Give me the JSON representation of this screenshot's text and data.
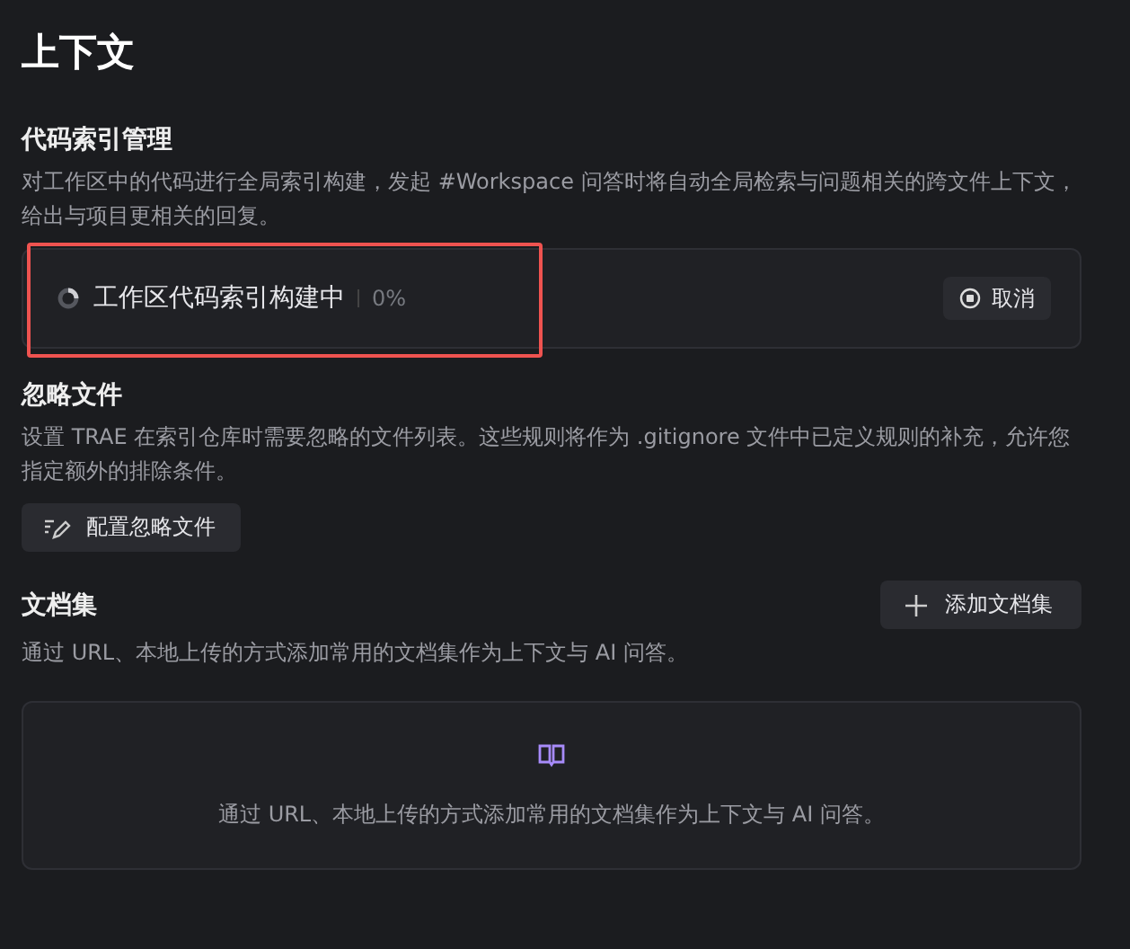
{
  "title": "上下文",
  "code_index": {
    "heading": "代码索引管理",
    "description": "对工作区中的代码进行全局索引构建，发起 #Workspace 问答时将自动全局检索与问题相关的跨文件上下文，给出与项目更相关的回复。",
    "status": {
      "label": "工作区代码索引构建中",
      "progress": "0%",
      "highlighted": true,
      "cancel_button": "取消"
    }
  },
  "ignore_files": {
    "heading": "忽略文件",
    "description": "设置 TRAE 在索引仓库时需要忽略的文件列表。这些规则将作为 .gitignore 文件中已定义规则的补充，允许您指定额外的排除条件。",
    "button": "配置忽略文件"
  },
  "docs": {
    "heading": "文档集",
    "add_button": "添加文档集",
    "description": "通过 URL、本地上传的方式添加常用的文档集作为上下文与 AI 问答。",
    "empty_text": "通过 URL、本地上传的方式添加常用的文档集作为上下文与 AI 问答。"
  }
}
